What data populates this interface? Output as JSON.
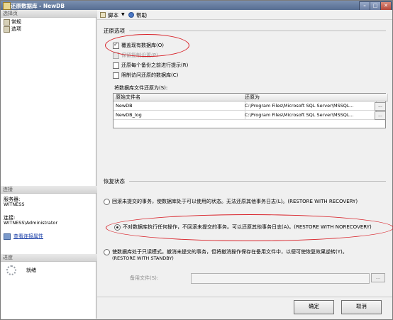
{
  "window": {
    "title": "还原数据库 - NewDB"
  },
  "left_panel": {
    "select_page_header": "选择页",
    "pages": [
      {
        "label": "常规"
      },
      {
        "label": "选项"
      }
    ],
    "connection_header": "连接",
    "server_label": "服务器:",
    "server_value": "WITNESS",
    "connection_label": "连接:",
    "connection_value": "WITNESS\\Administrator",
    "view_connection_link": "查看连接属性",
    "progress_header": "进度",
    "progress_status": "就绪"
  },
  "toolbar": {
    "script_label": "脚本",
    "help_label": "帮助"
  },
  "restore_options": {
    "title": "还原选项",
    "overwrite": {
      "label": "覆盖现有数据库(O)",
      "checked": true
    },
    "keep_replication": {
      "label": "保留复制设置(P)",
      "checked": false
    },
    "prompt_before_backup": {
      "label": "还原每个备份之前进行提示(R)",
      "checked": false
    },
    "restrict_access": {
      "label": "限制访问还原的数据库(C)",
      "checked": false
    },
    "restore_files_label": "将数据库文件还原为(S):",
    "files_grid": {
      "columns": [
        "原始文件名",
        "还原为"
      ],
      "rows": [
        {
          "original": "NewDB",
          "restore_as": "C:\\Program Files\\Microsoft SQL Server\\MSSQL..."
        },
        {
          "original": "NewDB_log",
          "restore_as": "C:\\Program Files\\Microsoft SQL Server\\MSSQL..."
        }
      ],
      "browse_label": "..."
    }
  },
  "recovery_state": {
    "title": "恢复状态",
    "options": [
      {
        "label": "回滚未提交的事务，使数据库处于可以使用的状态。无法还原其他事务日志(L)。(RESTORE WITH RECOVERY)",
        "selected": false
      },
      {
        "label": "不对数据库执行任何操作，不回滚未提交的事务。可以还原其他事务日志(A)。(RESTORE WITH NORECOVERY)",
        "selected": true
      },
      {
        "label_line1": "使数据库处于只读模式。撤消未提交的事务，但将撤消操作保存在备用文件中，以便可使恢复效果逆转(Y)。",
        "label_line2": "(RESTORE WITH STANDBY)",
        "selected": false
      }
    ],
    "standby_file_label": "备用文件(S):",
    "standby_browse": "..."
  },
  "buttons": {
    "ok": "确定",
    "cancel": "取消"
  },
  "colors": {
    "highlight_ellipse": "#d81f26",
    "title_bar": "#566d92",
    "link": "#1a3fa8"
  }
}
